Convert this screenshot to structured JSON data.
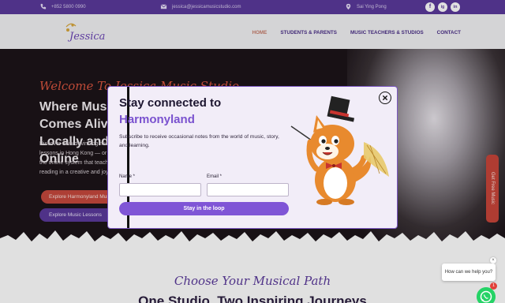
{
  "topbar": {
    "phone": "+852 5800 0990",
    "email": "jessica@jessicamusicstudio.com",
    "location": "Sai Ying Pong",
    "social": [
      "f",
      "ig",
      "in"
    ]
  },
  "nav": {
    "logo_text": "Jessica",
    "links": [
      "HOME",
      "STUDENTS & PARENTS",
      "MUSIC TEACHERS & STUDIOS",
      "CONTACT"
    ]
  },
  "hero": {
    "script": "Welcome To Jessica Music Studio",
    "heading": "Where Music Comes Alive – Locally and Online",
    "paragraph": "Discover award-winning music lessons in Hong Kong — or explore the online system that teaches music reading in a creative and joyful play.",
    "btn_primary": "Explore Harmonyland Music",
    "btn_secondary": "Explore Music Lessons",
    "side_tab": "Get Free Music"
  },
  "section": {
    "script": "Choose Your Musical Path",
    "title": "One Studio. Two Inspiring Journeys"
  },
  "modal": {
    "title_line1": "Stay connected to",
    "title_line2": "Harmonyland",
    "subtitle": "Subscribe to receive occasional notes from the world of music, story, and learning.",
    "name_label": "Name *",
    "email_label": "Email *",
    "submit": "Stay in the loop"
  },
  "chat": {
    "prompt": "How can we help you?",
    "badge": "1",
    "close": "×"
  },
  "colors": {
    "brand_purple": "#5b3a9b",
    "accent_purple": "#7f55d6",
    "accent_red": "#c5483d",
    "whatsapp_green": "#25d366"
  }
}
